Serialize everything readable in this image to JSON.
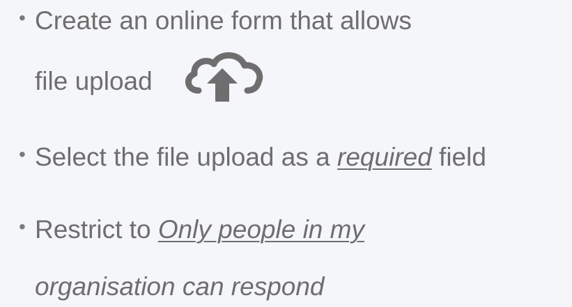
{
  "bullets": [
    {
      "line1": "Create an online form that allows",
      "line2": "file upload",
      "icon": "cloud-upload-icon"
    },
    {
      "before": "Select the file upload as a ",
      "emphasis": "required",
      "after": " field"
    },
    {
      "before": "Restrict to ",
      "emphasis_line1": "Only people in my",
      "emphasis_line2": "organisation can respond"
    }
  ],
  "colors": {
    "background": "#f5f6f9",
    "text": "#6e6e6e",
    "icon": "#6e6e6e"
  }
}
